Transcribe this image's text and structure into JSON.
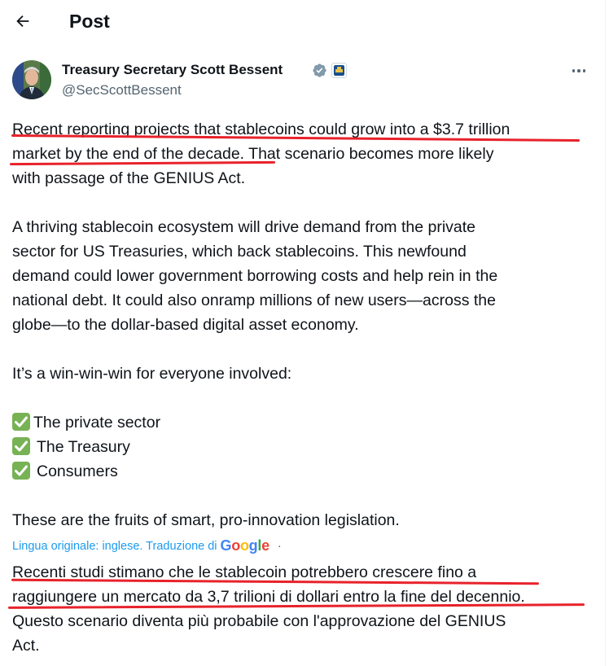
{
  "header": {
    "title": "Post",
    "back_icon": "arrow-left-icon"
  },
  "author": {
    "name": "Treasury Secretary Scott Bessent",
    "handle": "@SecScottBessent",
    "verified_color": "#829aab"
  },
  "post": {
    "lines": [
      "Recent reporting projects that stablecoins could grow into a $3.7 trillion",
      "market by the end of the decade. That scenario becomes more likely",
      "with passage of the GENIUS Act.",
      "A thriving stablecoin ecosystem will drive demand from the private",
      "sector for US Treasuries, which back stablecoins. This newfound",
      "demand could lower government borrowing costs and help rein in the",
      "national debt. It could also onramp millions of new users—across the",
      "globe—to the dollar-based digital asset economy.",
      "It’s a win-win-win for everyone involved:",
      "The private sector",
      "The Treasury",
      "Consumers",
      "These are the fruits of smart, pro-innovation legislation."
    ]
  },
  "translation": {
    "note": "Lingua originale: inglese. Traduzione di",
    "provider": "Google",
    "separator": "·",
    "lines": [
      "Recenti studi stimano che le stablecoin potrebbero crescere fino a",
      "raggiungere un mercato da 3,7 trilioni di dollari entro la fine del decennio.",
      "Questo scenario diventa più probabile con l'approvazione del GENIUS",
      "Act."
    ]
  },
  "colors": {
    "text": "#0f1419",
    "secondary": "#536471",
    "link": "#1d9bf0",
    "check_green": "#77b255",
    "annotation_red": "#e8222b"
  }
}
